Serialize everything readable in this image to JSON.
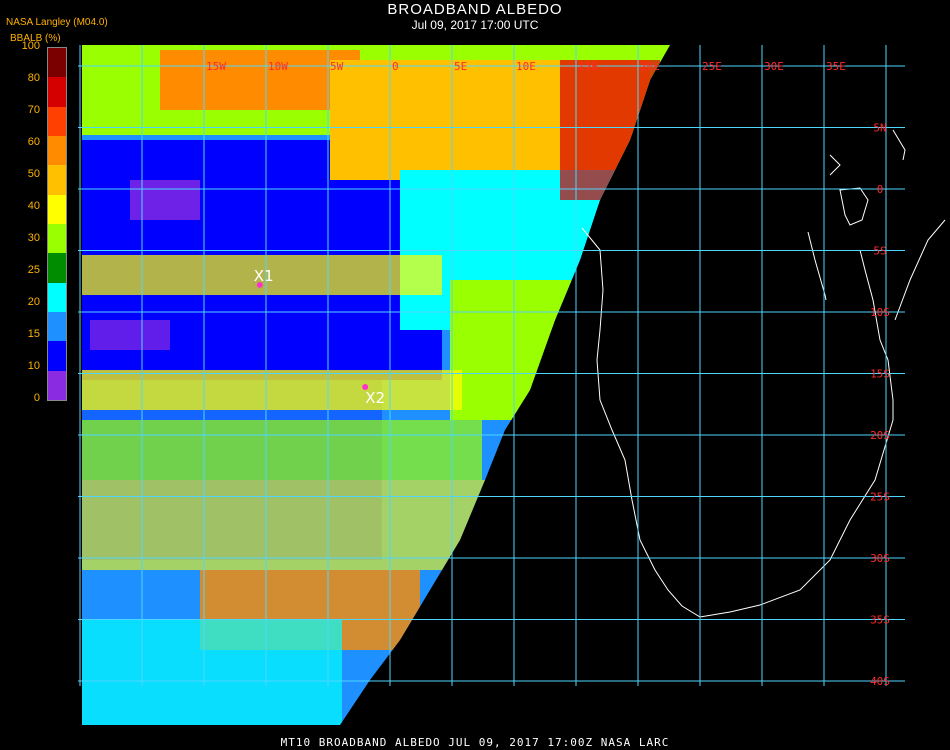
{
  "header": {
    "title": "BROADBAND ALBEDO",
    "subtitle": "Jul 09, 2017 17:00 UTC",
    "agency": "NASA Langley (M04.0)",
    "unit_label": "BBALB (%)"
  },
  "colorbar": {
    "ticks": [
      "100",
      "80",
      "70",
      "60",
      "50",
      "40",
      "30",
      "25",
      "20",
      "15",
      "10",
      "0"
    ],
    "colors": [
      "#7a0000",
      "#d40000",
      "#ff4000",
      "#ff8c00",
      "#ffc000",
      "#ffff00",
      "#9aff00",
      "#008c00",
      "#00ffff",
      "#1e90ff",
      "#0000ff",
      "#8a2be2"
    ]
  },
  "grid": {
    "lon_labels": [
      "15W",
      "10W",
      "5W",
      "0",
      "5E",
      "10E",
      "15E",
      "20E",
      "25E",
      "30E",
      "35E"
    ],
    "lat_labels": [
      "5N",
      "0",
      "5S",
      "10S",
      "15S",
      "20S",
      "25S",
      "30S",
      "35S",
      "40S"
    ],
    "color": "#4fd6ff"
  },
  "markers": [
    {
      "label": "X1",
      "lon": -10.5,
      "lat": -7.8
    },
    {
      "label": "X2",
      "lon": -2.0,
      "lat": -16.1
    }
  ],
  "footer": "MT10  BROADBAND ALBEDO   JUL 09, 2017 17:00Z   NASA LARC"
}
